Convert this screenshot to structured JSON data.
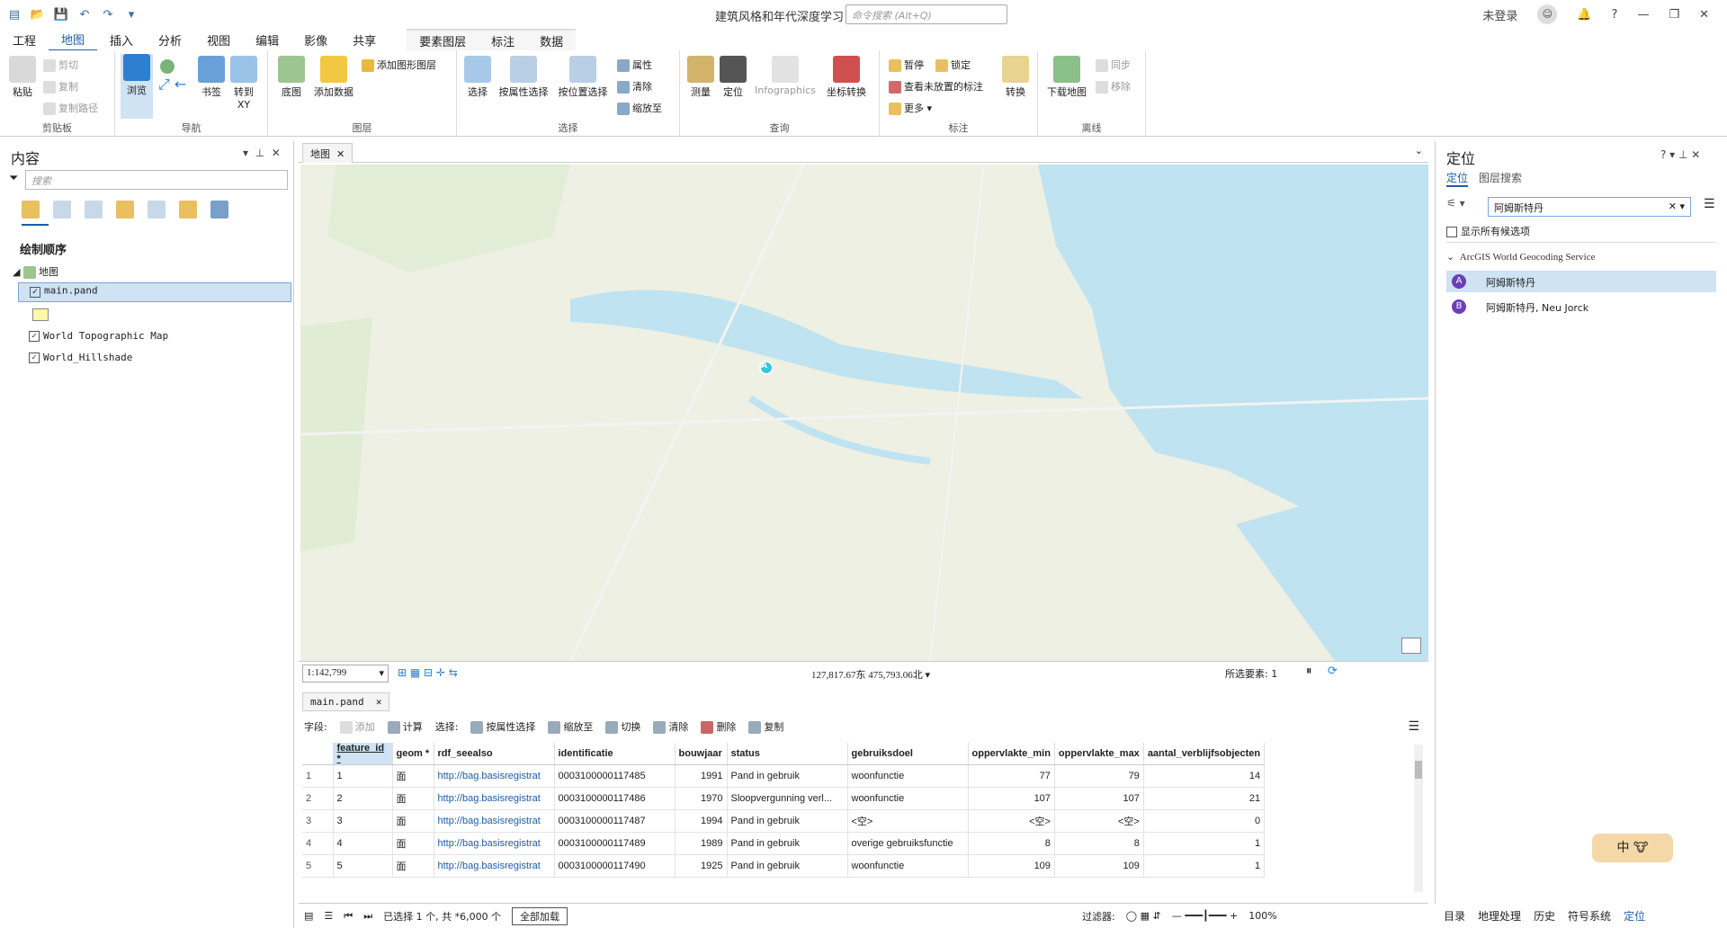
{
  "title_bar": {
    "app_title": "建筑风格和年代深度学习",
    "command_search_placeholder": "命令搜索 (Alt+Q)",
    "user": "未登录"
  },
  "tabs": [
    "工程",
    "地图",
    "插入",
    "分析",
    "视图",
    "编辑",
    "影像",
    "共享"
  ],
  "context_tabs": [
    "要素图层",
    "标注",
    "数据"
  ],
  "ribbon": {
    "clipboard": {
      "label": "剪贴板",
      "paste": "粘贴",
      "cut": "剪切",
      "copy": "复制",
      "copy_path": "复制路径"
    },
    "navigate": {
      "label": "导航",
      "explore": "浏览",
      "bookmarks": "书签",
      "goto_xy": "转到 XY"
    },
    "layer": {
      "label": "图层",
      "basemap": "底图",
      "add_data": "添加数据",
      "add_graphics": "添加图形图层"
    },
    "selection": {
      "label": "选择",
      "select": "选择",
      "select_by_attr": "按属性选择",
      "select_by_loc": "按位置选择",
      "attributes": "属性",
      "clear": "清除",
      "zoom_to": "缩放至"
    },
    "inquiry": {
      "label": "查询",
      "measure": "测量",
      "locate": "定位",
      "infographics": "Infographics",
      "coord_conv": "坐标转换"
    },
    "labeling": {
      "label": "标注",
      "pause": "暂停",
      "lock": "锁定",
      "view_unplaced": "查看未放置的标注",
      "more": "更多",
      "convert": "转换"
    },
    "offline": {
      "label": "离线",
      "download_map": "下载地图",
      "sync": "同步",
      "remove": "移除"
    }
  },
  "contents": {
    "title": "内容",
    "search_placeholder": "搜索",
    "draw_order": "绘制顺序",
    "map": "地图",
    "layers": [
      "main.pand",
      "World Topographic Map",
      "World_Hillshade"
    ]
  },
  "map": {
    "tab": "地图",
    "scale": "1:142,799",
    "coords": "127,817.67东 475,793.06北",
    "selected_features": "所选要素: 1",
    "marker": "A"
  },
  "table": {
    "tab": "main.pand",
    "field_label": "字段:",
    "add": "添加",
    "calculate": "计算",
    "selection_label": "选择:",
    "select_by_attr": "按属性选择",
    "zoom_to": "缩放至",
    "switch": "切换",
    "clear": "清除",
    "delete": "删除",
    "copy": "复制",
    "columns": [
      "feature_id *",
      "geom *",
      "rdf_seealso",
      "identificatie",
      "bouwjaar",
      "status",
      "gebruiksdoel",
      "oppervlakte_min",
      "oppervlakte_max",
      "aantal_verblijfsobjecten"
    ],
    "rows": [
      [
        "1",
        "1",
        "面",
        "http://bag.basisregistrat",
        "0003100000117485",
        "1991",
        "Pand in gebruik",
        "woonfunctie",
        "77",
        "79",
        "14"
      ],
      [
        "2",
        "2",
        "面",
        "http://bag.basisregistrat",
        "0003100000117486",
        "1970",
        "Sloopvergunning verl...",
        "woonfunctie",
        "107",
        "107",
        "21"
      ],
      [
        "3",
        "3",
        "面",
        "http://bag.basisregistrat",
        "0003100000117487",
        "1994",
        "Pand in gebruik",
        "<空>",
        "<空>",
        "<空>",
        "0"
      ],
      [
        "4",
        "4",
        "面",
        "http://bag.basisregistrat",
        "0003100000117489",
        "1989",
        "Pand in gebruik",
        "overige gebruiksfunctie",
        "8",
        "8",
        "1"
      ],
      [
        "5",
        "5",
        "面",
        "http://bag.basisregistrat",
        "0003100000117490",
        "1925",
        "Pand in gebruik",
        "woonfunctie",
        "109",
        "109",
        "1"
      ]
    ],
    "footer_selected": "已选择 1 个, 共 *6,000 个",
    "load_all": "全部加载",
    "filter": "过滤器:",
    "zoom": "100%"
  },
  "locate": {
    "title": "定位",
    "tab_locate": "定位",
    "tab_layer_search": "图层搜索",
    "query": "阿姆斯特丹",
    "show_all": "显示所有候选项",
    "service": "ArcGIS World Geocoding Service",
    "results": [
      {
        "badge": "A",
        "text": "阿姆斯特丹"
      },
      {
        "badge": "B",
        "text": "阿姆斯特丹, Neu Jorck"
      }
    ]
  },
  "bottom_tabs": [
    "目录",
    "地理处理",
    "历史",
    "符号系统",
    "定位"
  ],
  "ime": "中",
  "colors": {
    "accent": "#1a5ea8",
    "water": "#bfe3f0",
    "land": "#eef0e4",
    "marker": "#36c6e0",
    "selected_row": "#cce4f7"
  }
}
